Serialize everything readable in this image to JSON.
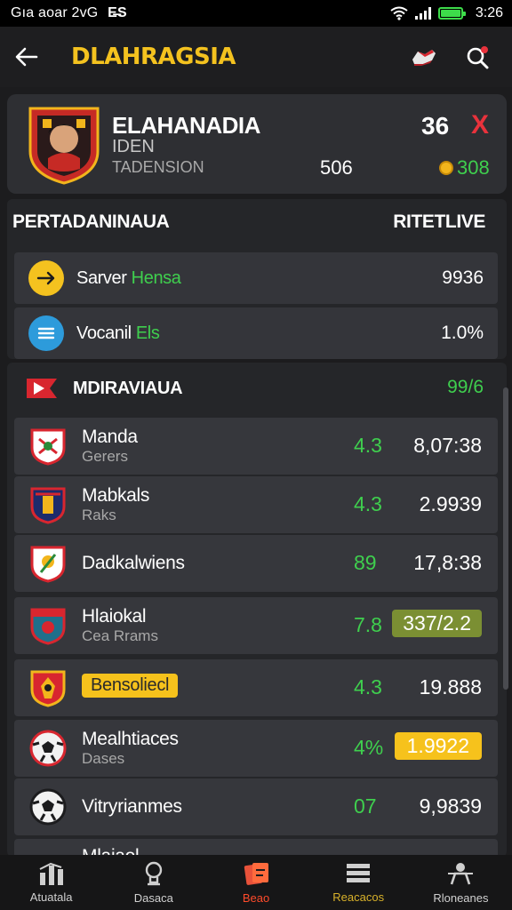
{
  "status_bar": {
    "left_text": "Gıa aoar 2vG",
    "left_badge": "E̶S",
    "time": "3:26"
  },
  "header": {
    "title": "DLAHRAGSIA"
  },
  "profile": {
    "name": "ELAHANADIA",
    "sub1": "IDEN",
    "sub2": "TADENSION",
    "mid_value": "506",
    "score": "36",
    "score_mark": "X",
    "coins": "308"
  },
  "performance": {
    "title": "PERTADANINAUA",
    "right_label": "RITETLIVE",
    "rows": [
      {
        "label_a": "Sarver ",
        "label_b": "Hensa",
        "value": "9936",
        "icon": "arrow-circle-icon",
        "color": "#f4c21f"
      },
      {
        "label_a": "Vocanil ",
        "label_b": "Els",
        "value": "1.0%",
        "icon": "menu-circle-icon",
        "color": "#2d9bdb"
      }
    ]
  },
  "teams": {
    "title": "MDIRAVIAUA",
    "value": "99/6",
    "rows": [
      {
        "name": "Manda",
        "sub": "Gerers",
        "rating": "4.3",
        "value": "8,07:38",
        "badge": ""
      },
      {
        "name": "Mabkals",
        "sub": "Raks",
        "rating": "4.3",
        "value": "2.9939",
        "badge": ""
      },
      {
        "name": "Dadkalwiens",
        "sub": "",
        "rating": "89",
        "value": "17,8:38",
        "badge": ""
      },
      {
        "name": "Hlaiokal",
        "sub": "Cea Rrams",
        "rating": "7.8",
        "value": "337/2.2",
        "badge": "olive"
      },
      {
        "name": "Bensoliecl",
        "sub": "",
        "rating": "4.3",
        "value": "19.888",
        "badge": "pill-name"
      },
      {
        "name": "Mealhtiaces",
        "sub": "Dases",
        "rating": "4%",
        "value": "1.9922",
        "badge": "yellow"
      },
      {
        "name": "Vitryrianmes",
        "sub": "",
        "rating": "07",
        "value": "9,9839",
        "badge": ""
      },
      {
        "name": "Mlaiaol",
        "sub": "",
        "rating": "",
        "value": "",
        "badge": ""
      }
    ]
  },
  "bottom_nav": [
    {
      "label": "Atuatala",
      "icon": "stats-icon"
    },
    {
      "label": "Dasaca",
      "icon": "trophy-icon"
    },
    {
      "label": "Beao",
      "icon": "cards-icon"
    },
    {
      "label": "Reacacos",
      "icon": "list-icon"
    },
    {
      "label": "Rloneanes",
      "icon": "team-icon"
    }
  ]
}
